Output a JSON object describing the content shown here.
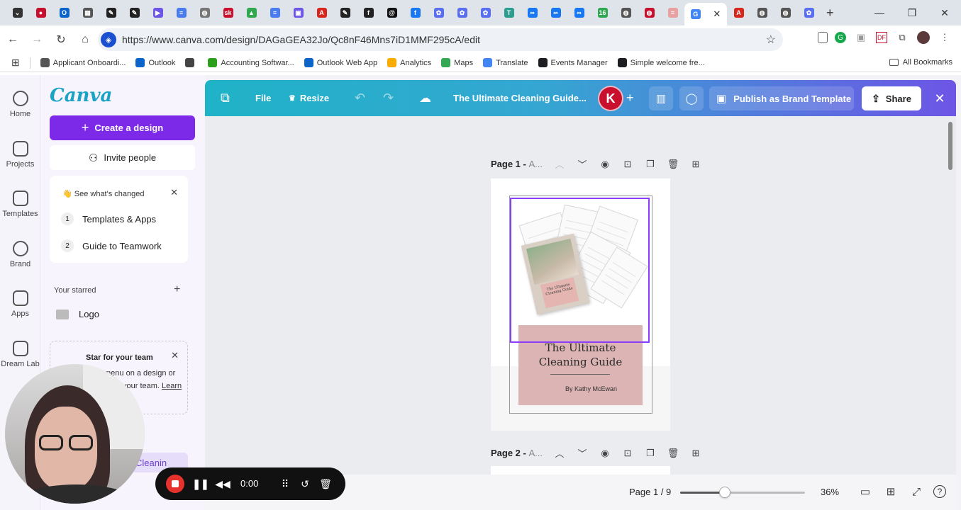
{
  "browser": {
    "tabs": [
      {
        "icon": "chevron-down",
        "color": "#333"
      },
      {
        "icon": "record",
        "color": "#c8102e"
      },
      {
        "icon": "outlook",
        "color": "#0a64c9"
      },
      {
        "icon": "grid",
        "color": "#555"
      },
      {
        "icon": "canva-dark",
        "color": "#222"
      },
      {
        "icon": "canva-dark",
        "color": "#222"
      },
      {
        "icon": "video",
        "color": "#6d55e6"
      },
      {
        "icon": "docs",
        "color": "#4a7cf0"
      },
      {
        "icon": "globe",
        "color": "#777"
      },
      {
        "icon": "sk",
        "color": "#c8102e"
      },
      {
        "icon": "drive",
        "color": "#2fa84f"
      },
      {
        "icon": "docs",
        "color": "#4a7cf0"
      },
      {
        "icon": "chat",
        "color": "#6d55e6"
      },
      {
        "icon": "adobe",
        "color": "#d9261c"
      },
      {
        "icon": "canva-dark",
        "color": "#222"
      },
      {
        "icon": "f",
        "color": "#222"
      },
      {
        "icon": "threads",
        "color": "#111"
      },
      {
        "icon": "facebook",
        "color": "#1877f2"
      },
      {
        "icon": "flower",
        "color": "#5a6ef0"
      },
      {
        "icon": "flower",
        "color": "#5a6ef0"
      },
      {
        "icon": "flower",
        "color": "#5a6ef0"
      },
      {
        "icon": "tm",
        "color": "#2a9d8f"
      },
      {
        "icon": "meta",
        "color": "#1877f2"
      },
      {
        "icon": "meta",
        "color": "#1877f2"
      },
      {
        "icon": "meta",
        "color": "#1877f2"
      },
      {
        "icon": "calendar",
        "color": "#2fa84f"
      },
      {
        "icon": "globe",
        "color": "#555"
      },
      {
        "icon": "globe",
        "color": "#c8102e"
      },
      {
        "icon": "doc-pink",
        "color": "#e9a0a0"
      }
    ],
    "active_tab_icon": "google",
    "tabs_after": [
      {
        "icon": "adobe",
        "color": "#d9261c"
      },
      {
        "icon": "globe",
        "color": "#555"
      },
      {
        "icon": "globe",
        "color": "#555"
      },
      {
        "icon": "flower",
        "color": "#5a6ef0"
      }
    ],
    "url": "https://www.canva.com/design/DAGaGEA32Jo/Qc8nF46Mns7iD1MMF295cA/edit",
    "bookmarks": [
      {
        "label": "Applicant Onboardi...",
        "color": "#555"
      },
      {
        "label": "Outlook",
        "color": "#0a64c9"
      },
      {
        "label": "",
        "color": "#444"
      },
      {
        "label": "Accounting Softwar...",
        "color": "#2ca01c"
      },
      {
        "label": "Outlook Web App",
        "color": "#0a64c9"
      },
      {
        "label": "Analytics",
        "color": "#f9ab00"
      },
      {
        "label": "Maps",
        "color": "#34a853"
      },
      {
        "label": "Translate",
        "color": "#4285f4"
      },
      {
        "label": "Events Manager",
        "color": "#1c1e21"
      },
      {
        "label": "Simple welcome fre...",
        "color": "#1c1e21"
      }
    ],
    "all_bookmarks": "All Bookmarks"
  },
  "rail": [
    {
      "label": "Home"
    },
    {
      "label": "Projects"
    },
    {
      "label": "Templates"
    },
    {
      "label": "Brand"
    },
    {
      "label": "Apps"
    },
    {
      "label": "Dream Lab"
    }
  ],
  "panel": {
    "logo": "Canva",
    "create_label": "Create a design",
    "invite_label": "Invite people",
    "changes_title": "👋 See what's changed",
    "changes_items": [
      {
        "num": "1",
        "label": "Templates & Apps"
      },
      {
        "num": "2",
        "label": "Guide to Teamwork"
      }
    ],
    "starred_label": "Your starred",
    "starred_item": "Logo",
    "team_title": "Star for your team",
    "team_body_1": "menu on a design or",
    "team_body_2": "your team.",
    "team_link": "Learn",
    "recent_item": "Cleanin"
  },
  "editor": {
    "file_label": "File",
    "resize_label": "Resize",
    "doc_title": "The Ultimate Cleaning Guide...",
    "avatar_letter": "K",
    "publish_label": "Publish as Brand Template",
    "share_label": "Share",
    "colors": {
      "accent": "#7d2ae8",
      "header_start": "#1fb3c7",
      "header_end": "#6d55e6",
      "avatar": "#c8102e"
    }
  },
  "canvas": {
    "page1_title": "Page 1 - ",
    "page1_suffix": "A...",
    "page2_title": "Page 2 - ",
    "page2_suffix": "A...",
    "cover_title": "The Ultimate Cleaning Guide",
    "cover_title_l1": "The Ultimate",
    "cover_title_l2": "Cleaning Guide",
    "cover_byline": "By Kathy McEwan"
  },
  "footer": {
    "page_count": "Page 1 / 9",
    "zoom_level": "36%",
    "zoom_fraction": 0.36
  },
  "recorder": {
    "time": "0:00"
  }
}
